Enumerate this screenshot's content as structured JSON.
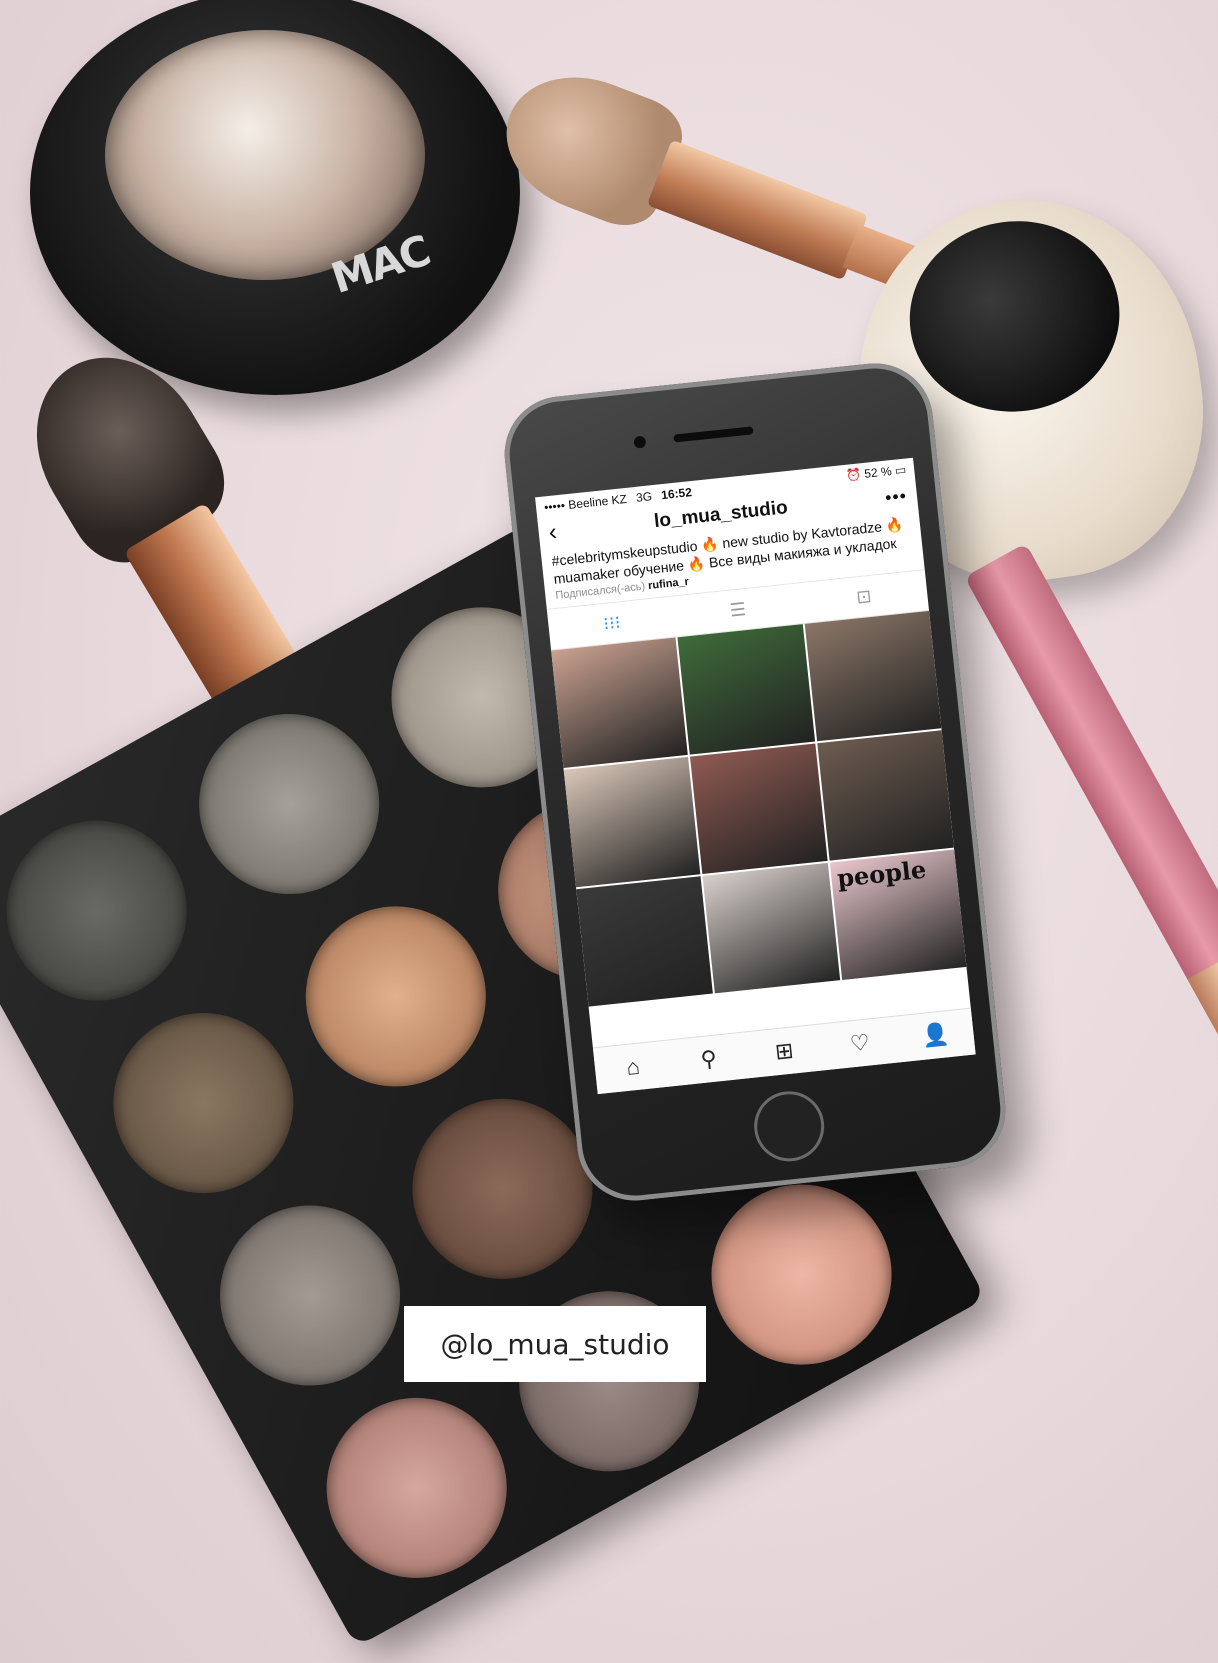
{
  "compact": {
    "brand_logo": "MAC"
  },
  "phone": {
    "status_bar": {
      "carrier": "••••• Beeline KZ",
      "network": "3G",
      "time": "16:52",
      "battery": "52 %"
    },
    "profile": {
      "username": "lo_mua_studio",
      "bio": "#celebritymskeupstudio 🔥 new studio by Kavtoradze 🔥 muamaker обучение 🔥 Все виды макияжа и укладок",
      "followed_by_prefix": "Подписался(-ась)",
      "followed_by_user": "rufina_r"
    },
    "tabs": [
      {
        "icon": "grid-icon",
        "active": true
      },
      {
        "icon": "list-icon",
        "active": false
      },
      {
        "icon": "tagged-icon",
        "active": false
      }
    ],
    "grid_posts": [
      {
        "desc": "portrait",
        "color": "#c9a190"
      },
      {
        "desc": "green",
        "color": "#3f6b3a"
      },
      {
        "desc": "two women",
        "color": "#8b7667"
      },
      {
        "desc": "before after",
        "color": "#d9c6b8"
      },
      {
        "desc": "group dresses",
        "color": "#8f5a52"
      },
      {
        "desc": "group",
        "color": "#6d5b50"
      },
      {
        "desc": "studio",
        "color": "#3a3a3a"
      },
      {
        "desc": "makeup",
        "color": "#d8cfcb"
      },
      {
        "desc": "magazine",
        "color": "#e9c7cc"
      }
    ],
    "magazine_text": "people",
    "tabbar": [
      "home-icon",
      "search-icon",
      "add-icon",
      "heart-icon",
      "profile-icon"
    ]
  },
  "handle_label": "@lo_mua_studio"
}
